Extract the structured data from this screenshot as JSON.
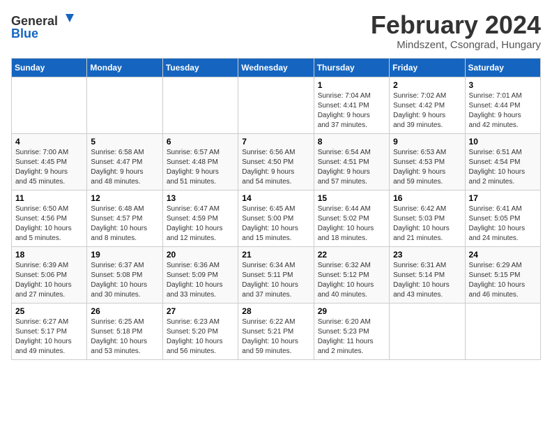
{
  "header": {
    "logo": {
      "general": "General",
      "blue": "Blue",
      "icon_alt": "GeneralBlue logo"
    },
    "title": "February 2024",
    "subtitle": "Mindszent, Csongrad, Hungary"
  },
  "calendar": {
    "days_of_week": [
      "Sunday",
      "Monday",
      "Tuesday",
      "Wednesday",
      "Thursday",
      "Friday",
      "Saturday"
    ],
    "weeks": [
      [
        {
          "day": "",
          "info": ""
        },
        {
          "day": "",
          "info": ""
        },
        {
          "day": "",
          "info": ""
        },
        {
          "day": "",
          "info": ""
        },
        {
          "day": "1",
          "info": "Sunrise: 7:04 AM\nSunset: 4:41 PM\nDaylight: 9 hours\nand 37 minutes."
        },
        {
          "day": "2",
          "info": "Sunrise: 7:02 AM\nSunset: 4:42 PM\nDaylight: 9 hours\nand 39 minutes."
        },
        {
          "day": "3",
          "info": "Sunrise: 7:01 AM\nSunset: 4:44 PM\nDaylight: 9 hours\nand 42 minutes."
        }
      ],
      [
        {
          "day": "4",
          "info": "Sunrise: 7:00 AM\nSunset: 4:45 PM\nDaylight: 9 hours\nand 45 minutes."
        },
        {
          "day": "5",
          "info": "Sunrise: 6:58 AM\nSunset: 4:47 PM\nDaylight: 9 hours\nand 48 minutes."
        },
        {
          "day": "6",
          "info": "Sunrise: 6:57 AM\nSunset: 4:48 PM\nDaylight: 9 hours\nand 51 minutes."
        },
        {
          "day": "7",
          "info": "Sunrise: 6:56 AM\nSunset: 4:50 PM\nDaylight: 9 hours\nand 54 minutes."
        },
        {
          "day": "8",
          "info": "Sunrise: 6:54 AM\nSunset: 4:51 PM\nDaylight: 9 hours\nand 57 minutes."
        },
        {
          "day": "9",
          "info": "Sunrise: 6:53 AM\nSunset: 4:53 PM\nDaylight: 9 hours\nand 59 minutes."
        },
        {
          "day": "10",
          "info": "Sunrise: 6:51 AM\nSunset: 4:54 PM\nDaylight: 10 hours\nand 2 minutes."
        }
      ],
      [
        {
          "day": "11",
          "info": "Sunrise: 6:50 AM\nSunset: 4:56 PM\nDaylight: 10 hours\nand 5 minutes."
        },
        {
          "day": "12",
          "info": "Sunrise: 6:48 AM\nSunset: 4:57 PM\nDaylight: 10 hours\nand 8 minutes."
        },
        {
          "day": "13",
          "info": "Sunrise: 6:47 AM\nSunset: 4:59 PM\nDaylight: 10 hours\nand 12 minutes."
        },
        {
          "day": "14",
          "info": "Sunrise: 6:45 AM\nSunset: 5:00 PM\nDaylight: 10 hours\nand 15 minutes."
        },
        {
          "day": "15",
          "info": "Sunrise: 6:44 AM\nSunset: 5:02 PM\nDaylight: 10 hours\nand 18 minutes."
        },
        {
          "day": "16",
          "info": "Sunrise: 6:42 AM\nSunset: 5:03 PM\nDaylight: 10 hours\nand 21 minutes."
        },
        {
          "day": "17",
          "info": "Sunrise: 6:41 AM\nSunset: 5:05 PM\nDaylight: 10 hours\nand 24 minutes."
        }
      ],
      [
        {
          "day": "18",
          "info": "Sunrise: 6:39 AM\nSunset: 5:06 PM\nDaylight: 10 hours\nand 27 minutes."
        },
        {
          "day": "19",
          "info": "Sunrise: 6:37 AM\nSunset: 5:08 PM\nDaylight: 10 hours\nand 30 minutes."
        },
        {
          "day": "20",
          "info": "Sunrise: 6:36 AM\nSunset: 5:09 PM\nDaylight: 10 hours\nand 33 minutes."
        },
        {
          "day": "21",
          "info": "Sunrise: 6:34 AM\nSunset: 5:11 PM\nDaylight: 10 hours\nand 37 minutes."
        },
        {
          "day": "22",
          "info": "Sunrise: 6:32 AM\nSunset: 5:12 PM\nDaylight: 10 hours\nand 40 minutes."
        },
        {
          "day": "23",
          "info": "Sunrise: 6:31 AM\nSunset: 5:14 PM\nDaylight: 10 hours\nand 43 minutes."
        },
        {
          "day": "24",
          "info": "Sunrise: 6:29 AM\nSunset: 5:15 PM\nDaylight: 10 hours\nand 46 minutes."
        }
      ],
      [
        {
          "day": "25",
          "info": "Sunrise: 6:27 AM\nSunset: 5:17 PM\nDaylight: 10 hours\nand 49 minutes."
        },
        {
          "day": "26",
          "info": "Sunrise: 6:25 AM\nSunset: 5:18 PM\nDaylight: 10 hours\nand 53 minutes."
        },
        {
          "day": "27",
          "info": "Sunrise: 6:23 AM\nSunset: 5:20 PM\nDaylight: 10 hours\nand 56 minutes."
        },
        {
          "day": "28",
          "info": "Sunrise: 6:22 AM\nSunset: 5:21 PM\nDaylight: 10 hours\nand 59 minutes."
        },
        {
          "day": "29",
          "info": "Sunrise: 6:20 AM\nSunset: 5:23 PM\nDaylight: 11 hours\nand 2 minutes."
        },
        {
          "day": "",
          "info": ""
        },
        {
          "day": "",
          "info": ""
        }
      ]
    ]
  }
}
